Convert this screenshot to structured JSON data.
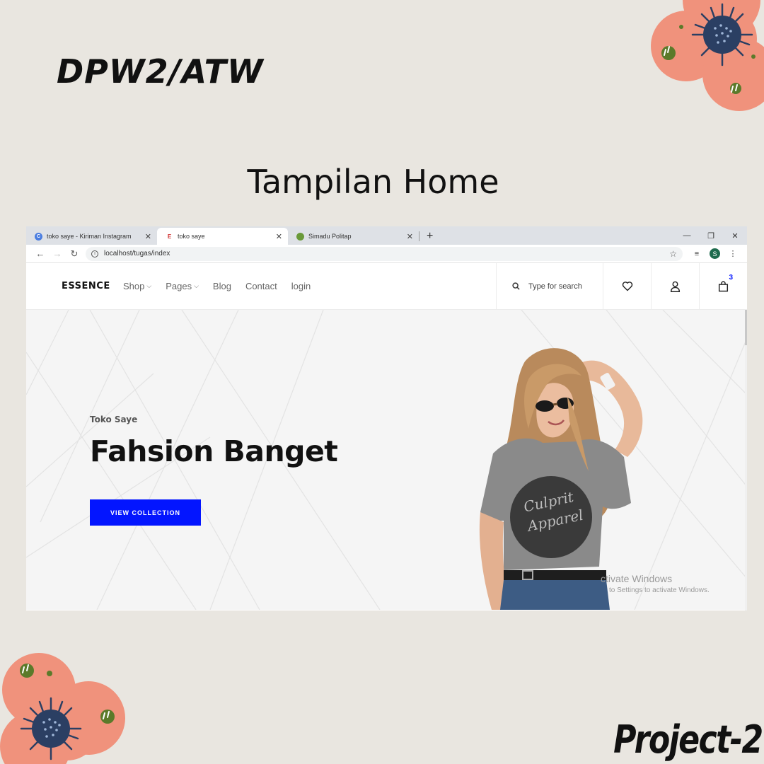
{
  "slide": {
    "title": "DPW2/ATW",
    "subtitle": "Tampilan Home",
    "footer": "Project-2"
  },
  "browser": {
    "tabs": [
      {
        "title": "toko saye - Kiriman Instagram",
        "favicon": "C",
        "active": false
      },
      {
        "title": "toko saye",
        "favicon": "E",
        "active": true
      },
      {
        "title": "Simadu Politap",
        "favicon": "",
        "active": false
      }
    ],
    "url": "localhost/tugas/index",
    "profile_initial": "S"
  },
  "site": {
    "logo": "ESSENCE",
    "menu": [
      "Shop",
      "Pages",
      "Blog",
      "Contact",
      "login"
    ],
    "search_placeholder": "Type for search",
    "cart_count": "3"
  },
  "hero": {
    "small": "Toko Saye",
    "title": "Fahsion Banget",
    "button": "VIEW COLLECTION",
    "shirt_text": "Culprit Apparel"
  },
  "watermark": {
    "line1": "ctivate Windows",
    "line2": "to Settings to activate Windows."
  },
  "colors": {
    "accent": "#0315ff",
    "background": "#e9e6e0",
    "flower": "#f0927c",
    "flower_center": "#2b3f63",
    "leaf": "#5b7a2a"
  }
}
